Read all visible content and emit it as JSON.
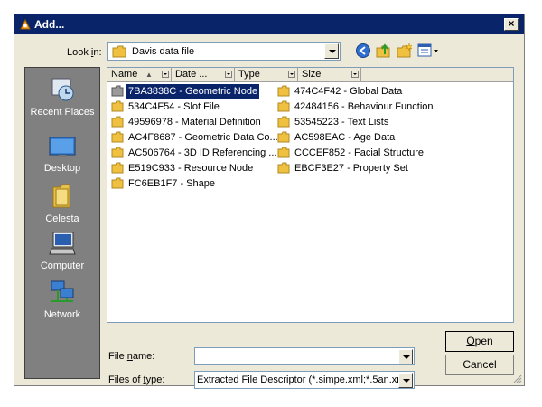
{
  "window": {
    "title": "Add...",
    "close_label": "×"
  },
  "lookin": {
    "label_pre": "Look ",
    "label_key": "i",
    "label_post": "n:",
    "value": "Davis data file"
  },
  "places": [
    {
      "label": "Recent Places",
      "icon": "recent-places-icon"
    },
    {
      "label": "Desktop",
      "icon": "desktop-icon"
    },
    {
      "label": "Celesta",
      "icon": "user-folder-icon"
    },
    {
      "label": "Computer",
      "icon": "computer-icon"
    },
    {
      "label": "Network",
      "icon": "network-icon"
    }
  ],
  "columns": [
    {
      "label": "Name"
    },
    {
      "label": "Date ..."
    },
    {
      "label": "Type"
    },
    {
      "label": "Size"
    }
  ],
  "files": [
    {
      "name": "7BA3838C - Geometric Node",
      "selected": true
    },
    {
      "name": "534C4F54 - Slot File"
    },
    {
      "name": "49596978 - Material Definition"
    },
    {
      "name": "AC4F8687 - Geometric Data Co..."
    },
    {
      "name": "AC506764 - 3D ID Referencing ..."
    },
    {
      "name": "E519C933 - Resource Node"
    },
    {
      "name": "FC6EB1F7 - Shape"
    },
    {
      "name": "474C4F42 - Global Data"
    },
    {
      "name": "42484156 - Behaviour Function"
    },
    {
      "name": "53545223 - Text Lists"
    },
    {
      "name": "AC598EAC - Age Data"
    },
    {
      "name": "CCCEF852 - Facial Structure"
    },
    {
      "name": "EBCF3E27 - Property Set"
    }
  ],
  "filename": {
    "label_pre": "File ",
    "label_key": "n",
    "label_post": "ame:",
    "value": ""
  },
  "filetype": {
    "label_pre": "Files of ",
    "label_key": "t",
    "label_post": "ype:",
    "value": "Extracted File Descriptor (*.simpe.xml;*.5an.xml;"
  },
  "buttons": {
    "open_key": "O",
    "open_rest": "pen",
    "cancel": "Cancel"
  },
  "colors": {
    "title_bar": "#0a246a",
    "dialog_bg": "#ece9d8",
    "places_bg": "#808080",
    "selection": "#0a246a",
    "folder": "#f0c040"
  }
}
